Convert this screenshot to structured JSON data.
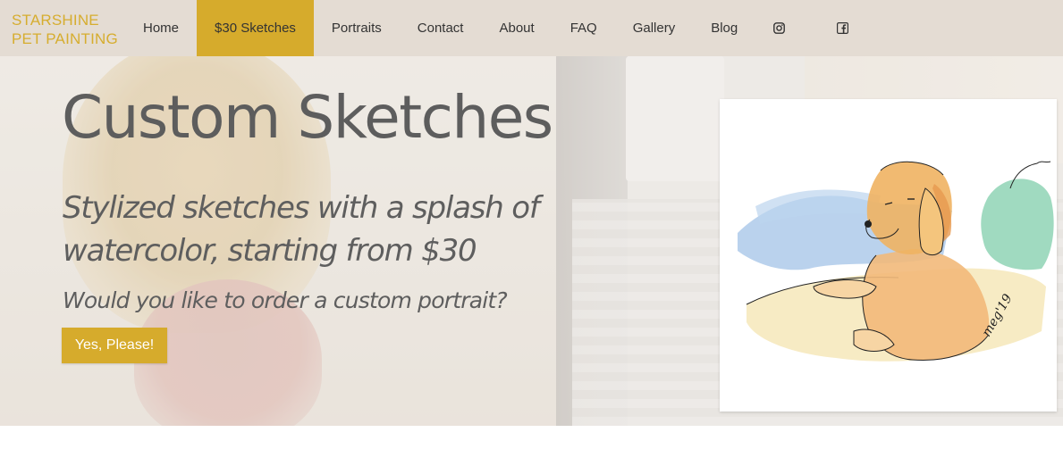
{
  "brand": {
    "line1": "STARSHINE",
    "line2": "PET PAINTING",
    "color": "#d6ad2f"
  },
  "nav": {
    "items": [
      {
        "label": "Home"
      },
      {
        "label": "$30 Sketches",
        "active": true
      },
      {
        "label": "Portraits"
      },
      {
        "label": "Contact"
      },
      {
        "label": "About"
      },
      {
        "label": "FAQ"
      },
      {
        "label": "Gallery"
      },
      {
        "label": "Blog"
      }
    ],
    "icons": [
      "instagram-icon",
      "facebook-icon"
    ],
    "background": "#e4dcd3",
    "active_color": "#d6ab2c"
  },
  "hero": {
    "title": "Custom Sketches",
    "subtitle": "Stylized sketches with a splash of watercolor, starting from $30",
    "question": "Would you like to order a custom portrait?",
    "cta_label": "Yes, Please!",
    "cta_color": "#d6ab2c"
  }
}
